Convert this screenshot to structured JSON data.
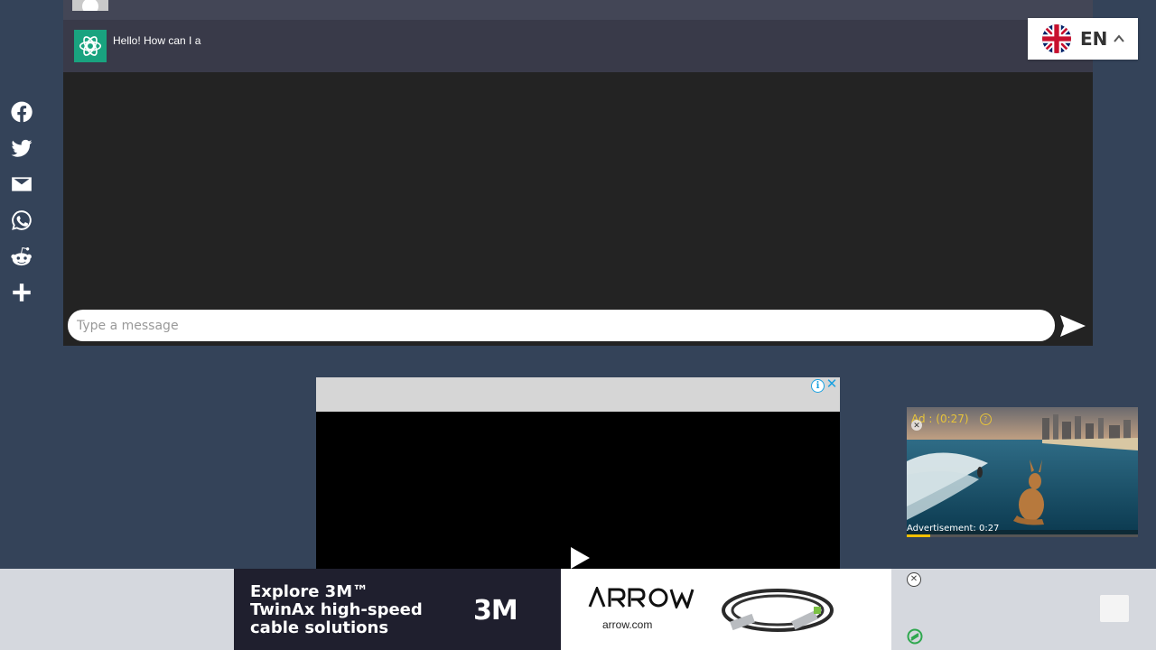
{
  "share": {
    "items": [
      "Facebook",
      "Twitter",
      "Email",
      "WhatsApp",
      "Reddit",
      "Share"
    ]
  },
  "chat": {
    "bot_message": "Hello! How can I a",
    "input_placeholder": "Type a message"
  },
  "language": {
    "code": "EN"
  },
  "right_ad": {
    "label": "Ad : (0:27)",
    "footer": "Advertisement: 0:27",
    "progress": 0.1
  },
  "banner": {
    "headline": "Explore 3M™ TwinAx high-speed cable solutions",
    "brand_3m": "3M",
    "url": "arrow.com"
  },
  "colors": {
    "page_bg": "#344359",
    "chat_bg": "#232323",
    "bot_row": "#393a49",
    "accent_green": "#19a37f",
    "ad_yellow": "#e7c43a"
  }
}
